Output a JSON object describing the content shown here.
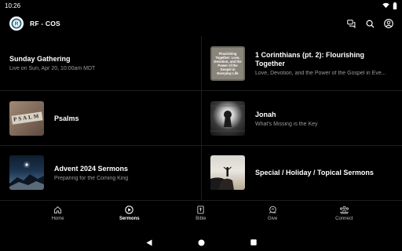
{
  "status": {
    "time": "10:26"
  },
  "app": {
    "title": "RF - COS",
    "actions": [
      {
        "name": "chat-icon"
      },
      {
        "name": "search-icon"
      },
      {
        "name": "account-icon"
      }
    ]
  },
  "sermons": {
    "featured": {
      "title": "Sunday Gathering",
      "subtitle": "Live on Sun, Apr 20, 10:00am MDT"
    },
    "series": [
      {
        "title": "1 Corinthians (pt. 2): Flourishing Together",
        "subtitle": "Love, Devotion, and the Power of the Gospel in Eve...",
        "thumb_text": "Flourishing Together: Love, Devotion, and the Power of the Gospel in Everyday Life"
      },
      {
        "title": "Psalms",
        "subtitle": "",
        "thumb_text": "PSALM"
      },
      {
        "title": "Jonah",
        "subtitle": "What's Missing is the Key"
      },
      {
        "title": "Advent 2024 Sermons",
        "subtitle": "Preparing for the Coming King"
      },
      {
        "title": "Special / Holiday / Topical Sermons",
        "subtitle": ""
      }
    ]
  },
  "nav": {
    "items": [
      {
        "label": "Home",
        "icon": "home-icon"
      },
      {
        "label": "Sermons",
        "icon": "play-circle-icon",
        "active": true
      },
      {
        "label": "Bible",
        "icon": "bible-icon"
      },
      {
        "label": "Give",
        "icon": "give-icon"
      },
      {
        "label": "Connect",
        "icon": "connect-icon"
      }
    ]
  }
}
